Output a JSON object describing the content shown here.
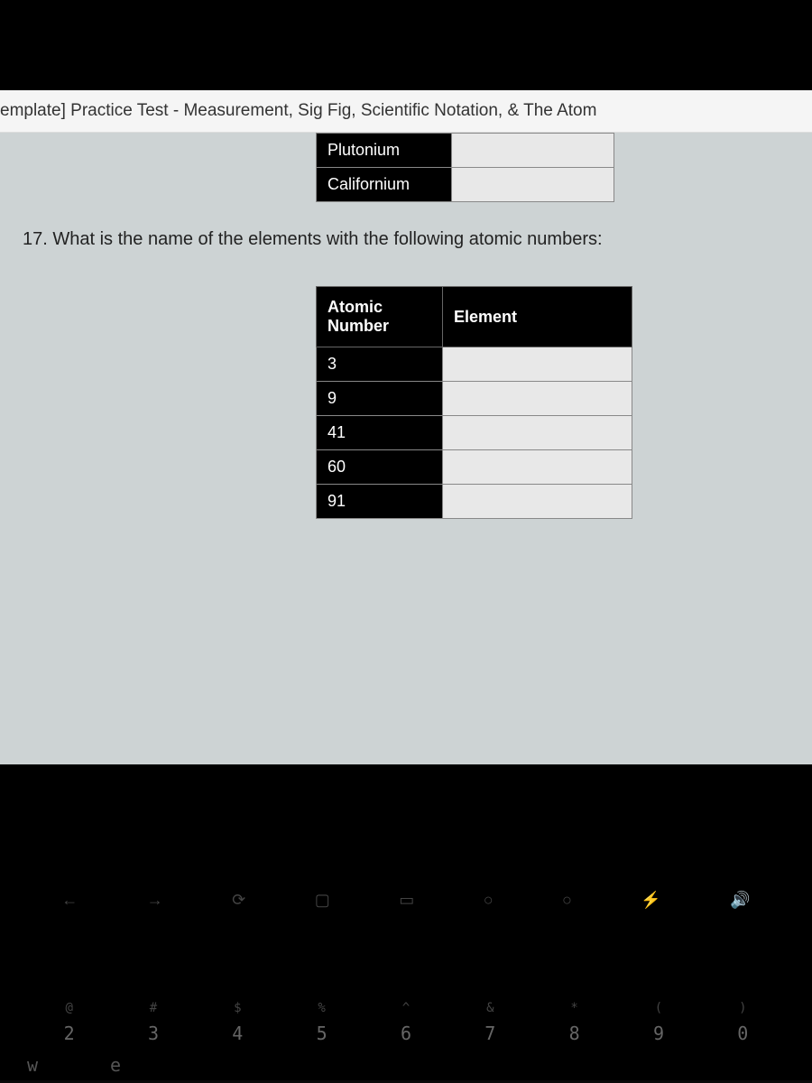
{
  "header": {
    "title": "emplate] Practice Test - Measurement, Sig Fig, Scientific Notation, & The Atom"
  },
  "prev_table": {
    "rows": [
      {
        "label": "Plutonium",
        "value": ""
      },
      {
        "label": "Californium",
        "value": ""
      }
    ]
  },
  "question": {
    "text": "17. What is the name of the elements with the following atomic numbers:"
  },
  "main_table": {
    "headers": {
      "col1": "Atomic Number",
      "col2": "Element"
    },
    "rows": [
      {
        "num": "3",
        "ans": ""
      },
      {
        "num": "9",
        "ans": ""
      },
      {
        "num": "41",
        "ans": ""
      },
      {
        "num": "60",
        "ans": ""
      },
      {
        "num": "91",
        "ans": ""
      }
    ]
  },
  "keyboard": {
    "keys": [
      {
        "sym": "@",
        "num": "2"
      },
      {
        "sym": "#",
        "num": "3"
      },
      {
        "sym": "$",
        "num": "4"
      },
      {
        "sym": "%",
        "num": "5"
      },
      {
        "sym": "^",
        "num": "6"
      },
      {
        "sym": "&",
        "num": "7"
      },
      {
        "sym": "*",
        "num": "8"
      },
      {
        "sym": "(",
        "num": "9"
      },
      {
        "sym": ")",
        "num": "0"
      }
    ],
    "letters": [
      "w",
      "e"
    ]
  },
  "nav": [
    "←",
    "→",
    "⟳",
    "▢",
    "▭",
    "○",
    "○",
    "⚡",
    "🔊"
  ]
}
